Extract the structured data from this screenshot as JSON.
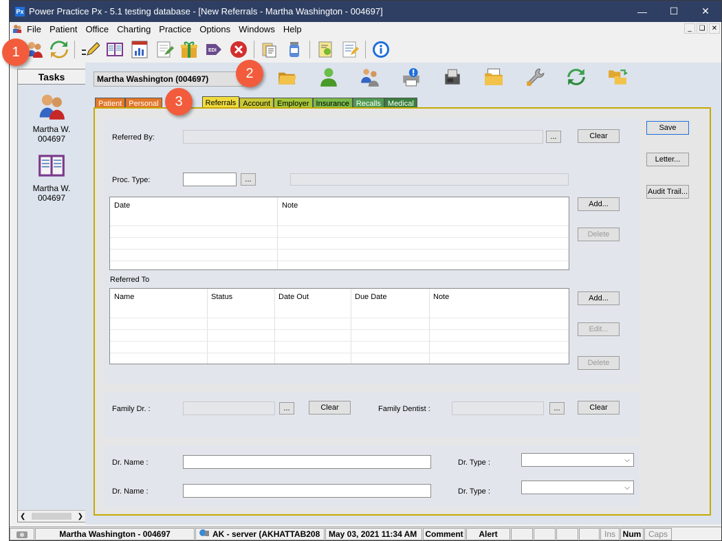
{
  "window": {
    "title": "Power Practice Px - 5.1 testing database - [New Referrals - Martha Washington - 004697]",
    "app_icon_text": "Px"
  },
  "menu": [
    "File",
    "Patient",
    "Office",
    "Charting",
    "Practice",
    "Options",
    "Windows",
    "Help"
  ],
  "callouts": [
    "1",
    "2",
    "3"
  ],
  "tasks": {
    "heading": "Tasks",
    "items": [
      {
        "line1": "Martha W.",
        "line2": "004697"
      },
      {
        "line1": "Martha W.",
        "line2": "004697"
      }
    ]
  },
  "patient_field": "Martha Washington (004697)",
  "tabs": [
    {
      "label": "Patient",
      "color": "#e1772a"
    },
    {
      "label": "Personal",
      "color": "#e1772a"
    },
    {
      "label": "Referrals",
      "color": "#f1dc3e",
      "active": true
    },
    {
      "label": "Account",
      "color": "#c8c838"
    },
    {
      "label": "Employer",
      "color": "#a4c639"
    },
    {
      "label": "Insurance",
      "color": "#79b84a"
    },
    {
      "label": "Recalls",
      "color": "#4f9a52"
    },
    {
      "label": "Medical",
      "color": "#3a7f3d"
    }
  ],
  "form": {
    "referred_by_label": "Referred By:",
    "proc_type_label": "Proc. Type:",
    "dots": "...",
    "clear": "Clear",
    "save": "Save",
    "letter": "Letter...",
    "audit_trail": "Audit Trail...",
    "add": "Add...",
    "delete": "Delete",
    "edit": "Edit...",
    "notes_grid": {
      "columns": [
        "Date",
        "Note"
      ]
    },
    "referred_to_label": "Referred To",
    "referred_to_grid": {
      "columns": [
        "Name",
        "Status",
        "Date Out",
        "Due Date",
        "Note"
      ]
    },
    "family_dr_label": "Family Dr. :",
    "family_dentist_label": "Family Dentist :",
    "dr_name_label": "Dr. Name :",
    "dr_type_label": "Dr. Type :"
  },
  "status_bar": {
    "patient": "Martha Washington - 004697",
    "server": "AK - server (AKHATTAB208",
    "datetime": "May 03, 2021 11:34 AM",
    "comment": "Comment",
    "alert": "Alert",
    "ins": "Ins",
    "num": "Num",
    "caps": "Caps"
  },
  "colors": {
    "title_bar": "#2f3f63",
    "panel_border": "#c7a900",
    "callout": "#f25c3c"
  }
}
